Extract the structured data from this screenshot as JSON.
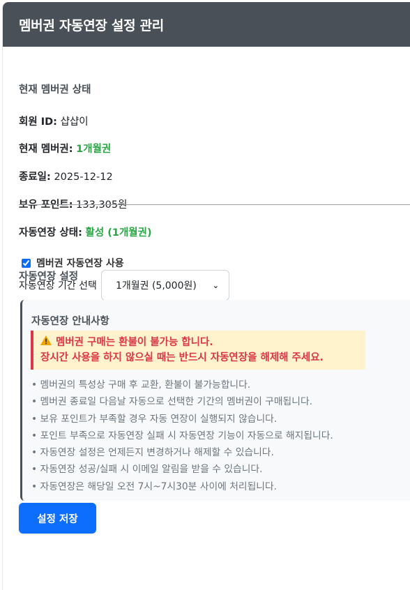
{
  "header": {
    "title": "멤버권 자동연장 설정 관리"
  },
  "status": {
    "title": "현재 멤버권 상태",
    "member_id_label": "회원 ID:",
    "member_id_value": "샵샵이",
    "membership_label": "현재 멤버권:",
    "membership_value": "1개월권",
    "end_date_label": "종료일:",
    "end_date_value": "2025-12-12",
    "points_label": "보유 포인트:",
    "points_value": "133,305원",
    "auto_label": "자동연장 상태:",
    "auto_value": "활성 (1개월권)"
  },
  "settings": {
    "title": "자동연장 설정",
    "checkbox_label": "멤버권 자동연장 사용",
    "checkbox_checked": true,
    "period_label": "자동연장 기간 선택",
    "period_selected": "1개월권 (5,000원)"
  },
  "info": {
    "title": "자동연장 안내사항",
    "warning_line1": "멤버권 구매는 환불이 불가능 합니다.",
    "warning_line2": "장시간 사용을 하지 않으실 때는 반드시 자동연장을 해제해 주세요.",
    "warning_icon": "warning-icon",
    "bullets": [
      "멤버권의 특성상 구매 후 교환, 환불이 불가능합니다.",
      "멤버권 종료일 다음날 자동으로 선택한 기간의 멤버권이 구매됩니다.",
      "보유 포인트가 부족할 경우 자동 연장이 실행되지 않습니다.",
      "포인트 부족으로 자동연장 실패 시 자동연장 기능이 자동으로 해지됩니다.",
      "자동연장 설정은 언제든지 변경하거나 해제할 수 있습니다.",
      "자동연장 성공/실패 시 이메일 알림을 받을 수 있습니다.",
      "자동연장은 해당일 오전 7시~7시30분 사이에 처리됩니다."
    ]
  },
  "actions": {
    "save_label": "설정 저장"
  },
  "colors": {
    "header_bg": "#495057",
    "accent": "#0d6efd",
    "success": "#28a745",
    "danger": "#dc3545",
    "warning_bg": "#fff3cd"
  }
}
